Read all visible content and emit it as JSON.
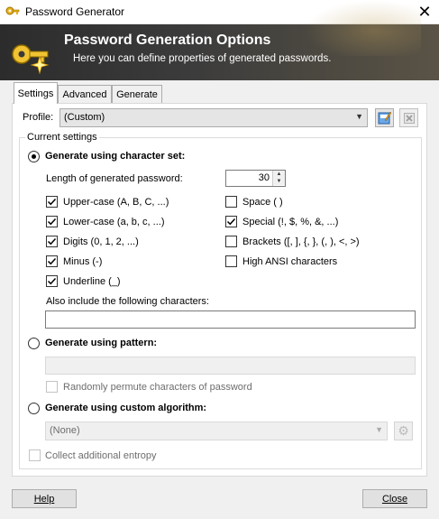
{
  "window": {
    "title": "Password Generator"
  },
  "banner": {
    "title": "Password Generation Options",
    "subtitle": "Here you can define properties of generated passwords."
  },
  "tabs": [
    {
      "label": "Settings",
      "active": true
    },
    {
      "label": "Advanced",
      "active": false
    },
    {
      "label": "Generate",
      "active": false
    }
  ],
  "profile": {
    "label": "Profile:",
    "value": "(Custom)"
  },
  "group": {
    "label": "Current settings"
  },
  "charset": {
    "label": "Generate using character set:",
    "selected": true,
    "length_label": "Length of generated password:",
    "length_value": "30",
    "options": [
      {
        "label": "Upper-case (A, B, C, ...)",
        "checked": true
      },
      {
        "label": "Lower-case (a, b, c, ...)",
        "checked": true
      },
      {
        "label": "Digits (0, 1, 2, ...)",
        "checked": true
      },
      {
        "label": "Minus (-)",
        "checked": true
      },
      {
        "label": "Underline (_)",
        "checked": true
      },
      {
        "label": "Space ( )",
        "checked": false
      },
      {
        "label": "Special (!, $, %, &, ...)",
        "checked": true
      },
      {
        "label": "Brackets ([, ], {, }, (, ), <, >)",
        "checked": false
      },
      {
        "label": "High ANSI characters",
        "checked": false
      }
    ],
    "include_label": "Also include the following characters:",
    "include_value": ""
  },
  "pattern": {
    "label": "Generate using pattern:",
    "selected": false,
    "value": "",
    "permute_label": "Randomly permute characters of password"
  },
  "custom": {
    "label": "Generate using custom algorithm:",
    "selected": false,
    "value": "(None)"
  },
  "entropy": {
    "label": "Collect additional entropy"
  },
  "buttons": {
    "help": "Help",
    "close": "Close"
  }
}
